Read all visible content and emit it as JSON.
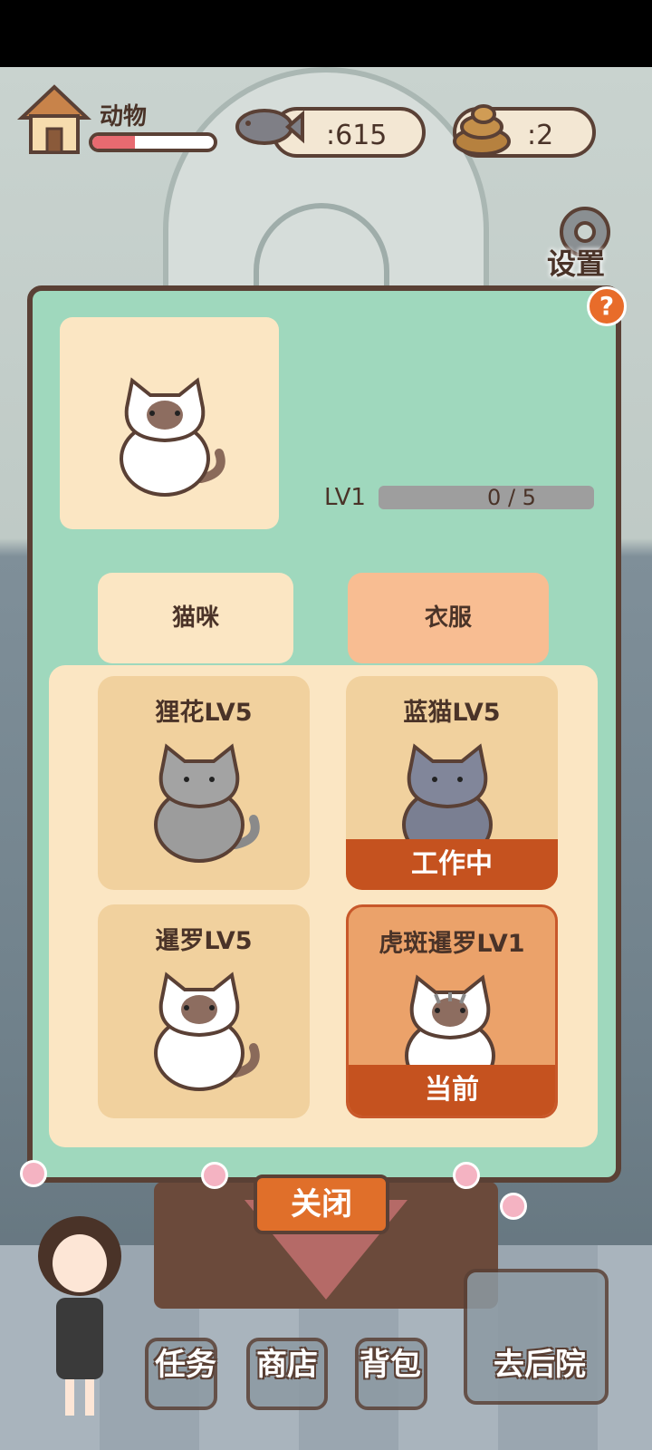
{
  "hud": {
    "animals_label": "动物",
    "animals_progress": 0.35,
    "fish_count": ":615",
    "poop_count": ":2",
    "settings_label": "设置"
  },
  "panel": {
    "help_label": "?",
    "level_label": "LV1",
    "level_progress": "0 / 5",
    "tabs": [
      {
        "label": "猫咪"
      },
      {
        "label": "衣服"
      }
    ],
    "cats": [
      {
        "name": "狸花LV5",
        "color": "gray-tabby",
        "status": ""
      },
      {
        "name": "蓝猫LV5",
        "color": "blue-gray",
        "status": "工作中"
      },
      {
        "name": "暹罗LV5",
        "color": "siamese",
        "status": ""
      },
      {
        "name": "虎斑暹罗LV1",
        "color": "tabby-siamese",
        "status": "当前"
      }
    ],
    "close_label": "关闭"
  },
  "nav": {
    "tasks": "任务",
    "shop": "商店",
    "bag": "背包",
    "backyard": "去后院"
  },
  "colors": {
    "panel_bg": "#9fd8bd",
    "accent": "#e06f2a",
    "card_bg": "#f1d19e"
  }
}
